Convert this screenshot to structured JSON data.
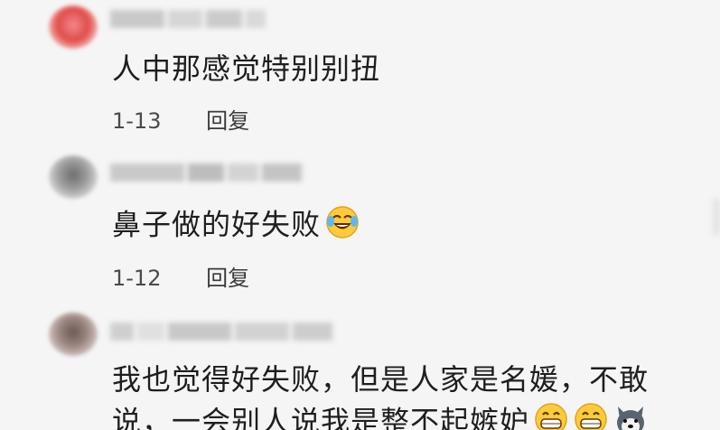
{
  "comments": [
    {
      "text": "人中那感觉特别别扭",
      "date": "1-13",
      "reply_label": "回复"
    },
    {
      "text": "鼻子做的好失败",
      "emoji": "laughing-tears-emoji",
      "date": "1-12",
      "reply_label": "回复"
    },
    {
      "text_line1": "我也觉得好失败，但是人家是名媛，不敢",
      "text_line2": "说，一会别人说我是整不起嫉妒",
      "emojis": [
        "grinning-emoji",
        "grinning-emoji",
        "husky-dog-emoji"
      ]
    }
  ],
  "colors": {
    "background": "#f5f5f5",
    "text": "#1e1e1e",
    "meta": "#4a4a4a"
  }
}
